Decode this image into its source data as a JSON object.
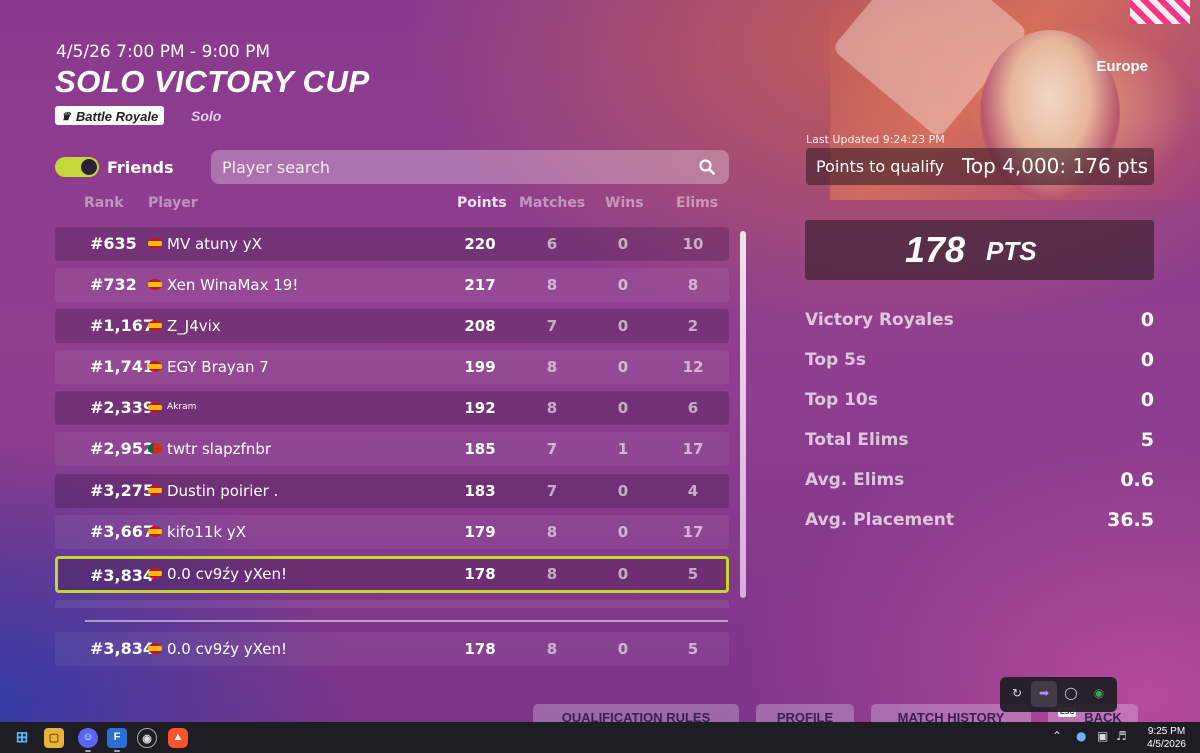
{
  "header": {
    "date_time": "4/5/26 7:00 PM - 9:00 PM",
    "title": "SOLO VICTORY CUP",
    "mode_badge": "Battle Royale",
    "mode_sub": "Solo",
    "region": "Europe"
  },
  "filters": {
    "friends_label": "Friends",
    "friends_on": true,
    "search_placeholder": "Player search"
  },
  "columns": {
    "rank": "Rank",
    "player": "Player",
    "points": "Points",
    "matches": "Matches",
    "wins": "Wins",
    "elims": "Elims"
  },
  "leaderboard": [
    {
      "rank": "#635",
      "flag": "es",
      "player": "MV atuny yX",
      "points": "220",
      "matches": "6",
      "wins": "0",
      "elims": "10"
    },
    {
      "rank": "#732",
      "flag": "es",
      "player": "Xen WinaMax 19!",
      "points": "217",
      "matches": "8",
      "wins": "0",
      "elims": "8"
    },
    {
      "rank": "#1,167",
      "flag": "es",
      "player": "Z_J4vix",
      "points": "208",
      "matches": "7",
      "wins": "0",
      "elims": "2"
    },
    {
      "rank": "#1,741",
      "flag": "es",
      "player": "EGY Brayan 7",
      "points": "199",
      "matches": "8",
      "wins": "0",
      "elims": "12"
    },
    {
      "rank": "#2,339",
      "flag": "es",
      "player": "Akram",
      "points": "192",
      "matches": "8",
      "wins": "0",
      "elims": "6"
    },
    {
      "rank": "#2,952",
      "flag": "pt",
      "player": "twtr slapzfnbr",
      "points": "185",
      "matches": "7",
      "wins": "1",
      "elims": "17"
    },
    {
      "rank": "#3,275",
      "flag": "es",
      "player": "Dustin poirier .",
      "points": "183",
      "matches": "7",
      "wins": "0",
      "elims": "4"
    },
    {
      "rank": "#3,667",
      "flag": "es",
      "player": "kifo11k yX",
      "points": "179",
      "matches": "8",
      "wins": "0",
      "elims": "17"
    },
    {
      "rank": "#3,834",
      "flag": "es",
      "player": "0.0 cv9źy yXen!",
      "points": "178",
      "matches": "8",
      "wins": "0",
      "elims": "5"
    }
  ],
  "my_row": {
    "rank": "#3,834",
    "flag": "es",
    "player": "0.0 cv9źy yXen!",
    "points": "178",
    "matches": "8",
    "wins": "0",
    "elims": "5"
  },
  "summary": {
    "last_updated": "Last Updated 9:24:23 PM",
    "qualify_label": "Points to qualify",
    "qualify_value": "Top 4,000: 176 pts",
    "points_value": "178",
    "points_unit": "PTS",
    "stats": [
      {
        "label": "Victory Royales",
        "value": "0"
      },
      {
        "label": "Top 5s",
        "value": "0"
      },
      {
        "label": "Top 10s",
        "value": "0"
      },
      {
        "label": "Total Elims",
        "value": "5"
      },
      {
        "label": "Avg. Elims",
        "value": "0.6"
      },
      {
        "label": "Avg. Placement",
        "value": "36.5"
      }
    ]
  },
  "bottom_buttons": {
    "qualification_rules": "QUALIFICATION RULES",
    "profile": "PROFILE",
    "match_history": "MATCH HISTORY",
    "back": "BACK",
    "back_key": "ESC"
  },
  "taskbar": {
    "time": "9:25 PM",
    "date": "4/5/2026"
  },
  "colors": {
    "accent_highlight": "#c3d630",
    "toggle_on": "#c5d83a"
  }
}
